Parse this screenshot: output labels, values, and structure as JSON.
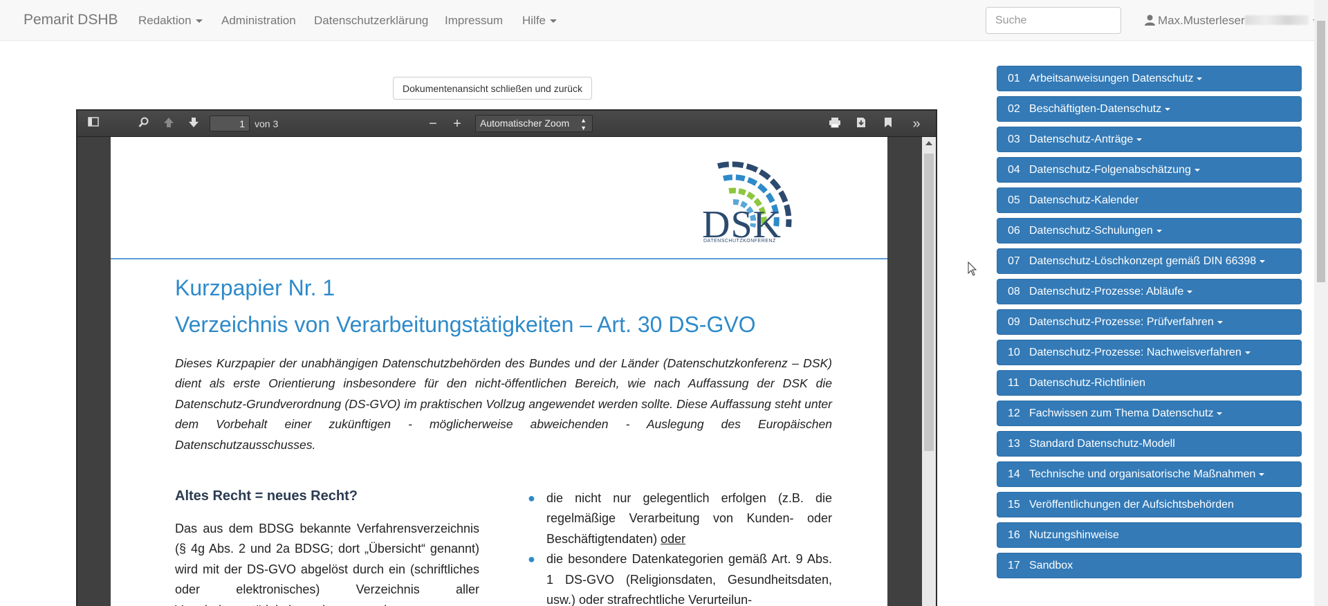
{
  "navbar": {
    "brand": "Pemarit DSHB",
    "items": [
      {
        "label": "Redaktion",
        "dropdown": true
      },
      {
        "label": "Administration",
        "dropdown": false
      },
      {
        "label": "Datenschutzerklärung",
        "dropdown": false
      },
      {
        "label": "Impressum",
        "dropdown": false
      },
      {
        "label": "Hilfe",
        "dropdown": true
      }
    ],
    "search_placeholder": "Suche",
    "user_name": "Max.Musterleser"
  },
  "close_button": "Dokumentenansicht schließen und zurück",
  "pdf_viewer": {
    "current_page": "1",
    "page_of": "von 3",
    "zoom": "Automatischer Zoom"
  },
  "document": {
    "logo_text": "DSK",
    "logo_subtext": "DATENSCHUTZKONFERENZ",
    "title_line1": "Kurzpapier Nr. 1",
    "title_line2": "Verzeichnis von Verarbeitungstätigkeiten – Art. 30 DS-GVO",
    "intro": "Dieses Kurzpapier der unabhängigen Datenschutzbehörden des Bundes und der Länder (Datenschutzkonferenz – DSK) dient als erste Orientierung insbesondere für den nicht-öffentlichen Bereich, wie nach Auffassung der DSK die Datenschutz-Grundverordnung (DS-GVO) im praktischen Vollzug angewendet werden sollte. Diese Auffassung steht unter dem Vorbehalt einer zukünftigen - möglicherweise abweichenden - Auslegung des Europäischen Datenschutzausschusses.",
    "section_heading": "Altes Recht = neues Recht?",
    "section_text": "Das aus dem BDSG bekannte Verfahrensverzeichnis (§ 4g Abs. 2 und 2a BDSG; dort „Übersicht“ genannt) wird mit der DS-GVO abgelöst durch ein (schriftliches oder elektronisches) Verzeichnis aller Verarbeitungstätigkeiten mit personenbezogenen",
    "bullet1": "die nicht nur gelegentlich erfolgen (z.B. die regelmäßige Verarbeitung von Kunden- oder Beschäftigtendaten)",
    "bullet1_suffix": "oder",
    "bullet2": "die besondere Datenkategorien gemäß Art. 9 Abs. 1 DS-GVO (Religionsdaten, Gesundheitsdaten, usw.) oder strafrechtliche Verurteilun-"
  },
  "sidebar": {
    "items": [
      {
        "num": "01",
        "label": "Arbeitsanweisungen Datenschutz",
        "dropdown": true
      },
      {
        "num": "02",
        "label": "Beschäftigten-Datenschutz",
        "dropdown": true
      },
      {
        "num": "03",
        "label": "Datenschutz-Anträge",
        "dropdown": true
      },
      {
        "num": "04",
        "label": "Datenschutz-Folgenabschätzung",
        "dropdown": true
      },
      {
        "num": "05",
        "label": "Datenschutz-Kalender",
        "dropdown": false
      },
      {
        "num": "06",
        "label": "Datenschutz-Schulungen",
        "dropdown": true
      },
      {
        "num": "07",
        "label": "Datenschutz-Löschkonzept gemäß DIN 66398",
        "dropdown": true
      },
      {
        "num": "08",
        "label": "Datenschutz-Prozesse: Abläufe",
        "dropdown": true
      },
      {
        "num": "09",
        "label": "Datenschutz-Prozesse: Prüfverfahren",
        "dropdown": true
      },
      {
        "num": "10",
        "label": "Datenschutz-Prozesse: Nachweisverfahren",
        "dropdown": true
      },
      {
        "num": "11",
        "label": "Datenschutz-Richtlinien",
        "dropdown": false
      },
      {
        "num": "12",
        "label": "Fachwissen zum Thema Datenschutz",
        "dropdown": true
      },
      {
        "num": "13",
        "label": "Standard Datenschutz-Modell",
        "dropdown": false
      },
      {
        "num": "14",
        "label": "Technische und organisatorische Maßnahmen",
        "dropdown": true
      },
      {
        "num": "15",
        "label": "Veröffentlichungen der Aufsichtsbehörden",
        "dropdown": false
      },
      {
        "num": "16",
        "label": "Nutzungshinweise",
        "dropdown": false
      },
      {
        "num": "17",
        "label": "Sandbox",
        "dropdown": false
      }
    ]
  },
  "colors": {
    "accent": "#337ab7",
    "doc_title": "#2e8ac9",
    "navbar_bg": "#f8f8f8"
  }
}
